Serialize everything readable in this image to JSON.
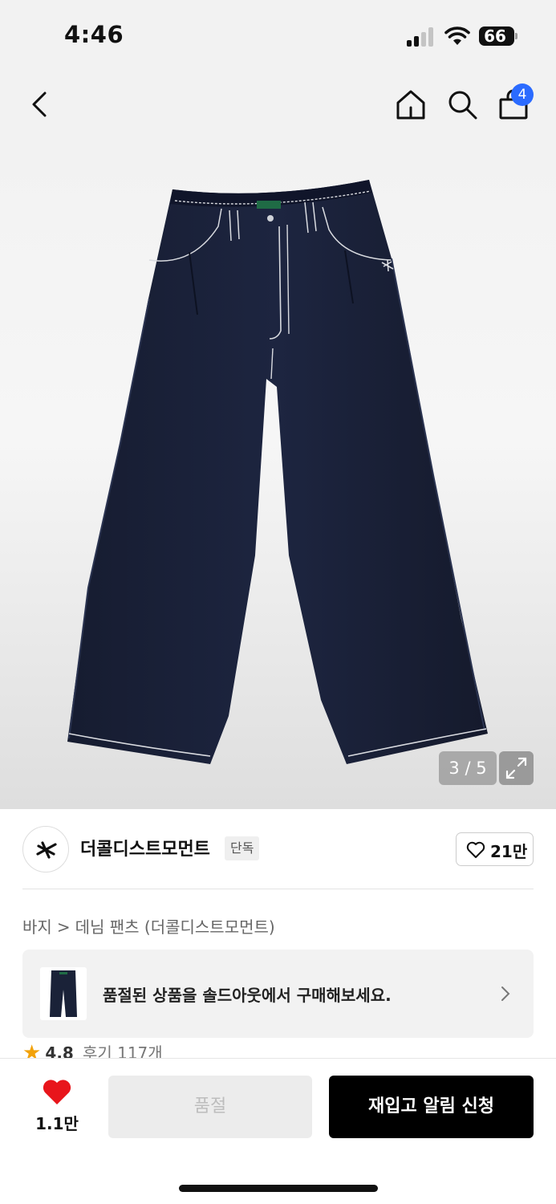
{
  "status_bar": {
    "time": "4:46",
    "battery": "66"
  },
  "nav": {
    "cart_count": "4",
    "icons": [
      "back-icon",
      "home-icon",
      "search-icon",
      "shopping-bag-icon"
    ]
  },
  "gallery": {
    "counter": "3 / 5",
    "current": 3,
    "total": 5
  },
  "brand": {
    "name": "더콜디스트모먼트",
    "tag": "단독",
    "likes": "21만"
  },
  "breadcrumb": {
    "category": "바지",
    "separator": ">",
    "subcategory": "데님 팬츠 (더콜디스트모먼트)"
  },
  "soldout_banner": {
    "text": "품절된 상품을 솔드아웃에서 구매해보세요."
  },
  "rating": {
    "score": "4.8",
    "reviews": "후기 117개"
  },
  "actions": {
    "wish_count": "1.1만",
    "soldout_label": "품절",
    "restock_label": "재입고 알림 신청"
  },
  "colors": {
    "accent_blue": "#2b6bff",
    "heart_red": "#e8151b",
    "star_orange": "#f2a20a",
    "denim": "#1a2238"
  }
}
